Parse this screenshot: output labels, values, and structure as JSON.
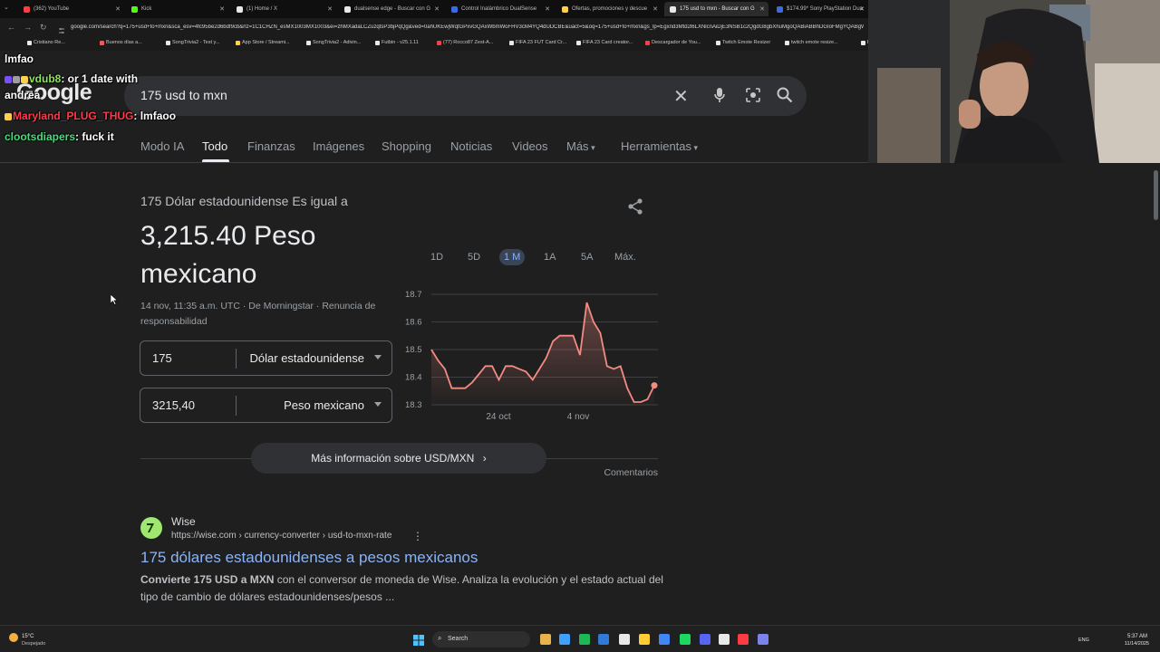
{
  "browser": {
    "tabs": [
      {
        "label": "(362) YouTube",
        "color": "#ff3d3d",
        "active": false
      },
      {
        "label": "Kick",
        "color": "#53fc18",
        "active": false
      },
      {
        "label": "(1) Home / X",
        "color": "#e8e8e8",
        "active": false
      },
      {
        "label": "dualsense edge - Buscar con G",
        "color": "#e8e8e8",
        "active": false
      },
      {
        "label": "Control Inalámbrico DualSense",
        "color": "#3b6ae6",
        "active": false
      },
      {
        "label": "Ofertas, promociones y descue",
        "color": "#ffd04a",
        "active": false
      },
      {
        "label": "175 usd to mxn - Buscar con G",
        "color": "#e8e8e8",
        "active": true
      },
      {
        "label": "$174.99* Sony PlayStation Dua",
        "color": "#3b6ae6",
        "active": false
      }
    ],
    "url": "google.com/search?q=175+usd+to+mxn&sca_esv=4fc95be2d6bdf9cb&rlz=1C1CHZN_esMX1003MX1003&ei=zhMXadaLCZuzqtsP3bjPqQg&ved=0ahUKEwjWqtGPxvGQAxWbmWoFHV3cM4YQ4dUDCBE&uact=5&oq=175+usd+to+mxn&gs_lp=Egxnd3Mtd2l6LXNlcnAiDjE3NSB1c2QgdG8gbXhuMgoQABiABBhDGIoFMgYQABgWGB4",
    "bookmarks": [
      {
        "label": "Cristiano Re...",
        "color": "#e8e8e8"
      },
      {
        "label": "Buenos días a...",
        "color": "#ff5252"
      },
      {
        "label": "SongTrivia2 - Test y...",
        "color": "#e8e8e8"
      },
      {
        "label": "App Store / Streami...",
        "color": "#ffd04a"
      },
      {
        "label": "SongTrivia2 - Adivin...",
        "color": "#e8e8e8"
      },
      {
        "label": "Futbin - v25.1.11",
        "color": "#e8e8e8"
      },
      {
        "label": "(77) Rocco87 Zest-A...",
        "color": "#ff3d3d"
      },
      {
        "label": "FIFA 23 FUT Card Cr...",
        "color": "#e8e8e8"
      },
      {
        "label": "FIFA 23 Card creator...",
        "color": "#e8e8e8"
      },
      {
        "label": "Descargador de You...",
        "color": "#ff3d3d"
      },
      {
        "label": "Twitch Emote Resizer",
        "color": "#e8e8e8"
      },
      {
        "label": "twitch emote resize...",
        "color": "#e8e8e8"
      },
      {
        "label": "Es",
        "color": "#e8e8e8"
      }
    ]
  },
  "google": {
    "logo": "Google",
    "query": "175 usd to mxn",
    "nav": [
      "Modo IA",
      "Todo",
      "Finanzas",
      "Imágenes",
      "Shopping",
      "Noticias",
      "Videos",
      "Más",
      "Herramientas"
    ],
    "active_nav": "Todo"
  },
  "chat": [
    {
      "user": "",
      "text": "lmfao"
    },
    {
      "user": "vdub8",
      "text": ": or 1 date with"
    },
    {
      "user": "",
      "text": "andrea"
    },
    {
      "user": "Maryland_PLUG_THUG",
      "text": ": lmfaoo"
    },
    {
      "user": "clootsdiapers",
      "text": ": fuck it"
    }
  ],
  "converter": {
    "label": "175 Dólar estadounidense Es igual a",
    "result": "3,215.40 Peso mexicano",
    "meta": "14 nov, 11:35 a.m. UTC · De Morningstar · Renuncia de responsabilidad",
    "from_amount": "175",
    "from_currency": "Dólar estadounidense",
    "to_amount": "3215,40",
    "to_currency": "Peso mexicano",
    "ranges": [
      "1D",
      "5D",
      "1 M",
      "1A",
      "5A",
      "Máx."
    ],
    "active_range": "1 M",
    "more_button": "Más información sobre USD/MXN",
    "comments": "Comentarios"
  },
  "chart_data": {
    "type": "area",
    "ylim": [
      18.3,
      18.7
    ],
    "yticks": [
      "18.7",
      "18.6",
      "18.5",
      "18.4",
      "18.3"
    ],
    "xticks": [
      "24 oct",
      "4 nov"
    ],
    "color": "#f28b82",
    "values": [
      18.5,
      18.46,
      18.43,
      18.36,
      18.36,
      18.36,
      18.38,
      18.41,
      18.44,
      18.44,
      18.39,
      18.44,
      18.44,
      18.43,
      18.42,
      18.39,
      18.43,
      18.47,
      18.53,
      18.55,
      18.55,
      18.55,
      18.48,
      18.67,
      18.6,
      18.56,
      18.44,
      18.43,
      18.44,
      18.36,
      18.31,
      18.31,
      18.32,
      18.37
    ]
  },
  "result": {
    "site": "Wise",
    "url": "https://wise.com › currency-converter › usd-to-mxn-rate",
    "title": "175 dólares estadounidenses a pesos mexicanos",
    "snippet_bold": "Convierte 175 USD a MXN",
    "snippet": " con el conversor de moneda de Wise. Analiza la evolución y el estado actual del tipo de cambio de dólares estadounidenses/pesos ..."
  },
  "taskbar": {
    "temp": "15°C",
    "weather": "Despejado",
    "search": "Search",
    "lang": "ENG",
    "time": "5:37 AM",
    "date": "11/14/2025"
  }
}
